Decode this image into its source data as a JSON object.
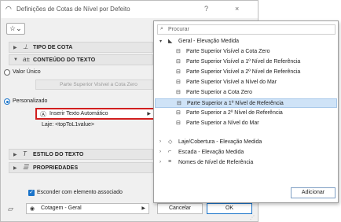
{
  "window": {
    "title": "Definições de Cotas de Nível por Defeito",
    "help_label": "?",
    "close_label": "×"
  },
  "toolbar": {
    "favorites_icon": "star-icon",
    "favorites_caret": "⌄"
  },
  "sections": {
    "tipo_de_cota": "TIPO DE COTA",
    "conteudo_do_texto": "CONTEÚDO DO TEXTO",
    "estilo_do_texto": "ESTILO DO TEXTO",
    "propriedades": "PROPRIEDADES"
  },
  "content": {
    "valor_unico_label": "Valor Único",
    "valor_unico_value": "Parte Superior Visível a Cota Zero",
    "personalizado_label": "Personalizado",
    "inserir_texto_label": "Inserir Texto Automático",
    "expression": "Laje: <topToL1value>"
  },
  "footer": {
    "hide_with_element_label": "Esconder com elemento associado",
    "layer_value": "Cotagem - Geral",
    "cancel_label": "Cancelar",
    "ok_label": "OK"
  },
  "popup": {
    "search_placeholder": "Procurar",
    "group_label": "Geral - Elevação Medida",
    "items": [
      "Parte Superior Visível a Cota Zero",
      "Parte Superior Visível a 1º Nível de Referência",
      "Parte Superior Visível a 2º Nível de Referência",
      "Parte Superior Visível a Nível do Mar",
      "Parte Superior a Cota Zero",
      "Parte Superior a 1º Nível de Referência",
      "Parte Superior a 2º Nível de Referência",
      "Parte Superior a Nível do Mar"
    ],
    "selected_index": 5,
    "collapsed_groups": [
      "Laje/Cobertura - Elevação Medida",
      "Escada - Elevação Medida",
      "Nomes de Nível de Referência"
    ],
    "add_label": "Adicionar"
  },
  "colors": {
    "accent": "#1a73c9",
    "highlight_border": "#d11f1f",
    "selection": "#cfe3f7"
  }
}
